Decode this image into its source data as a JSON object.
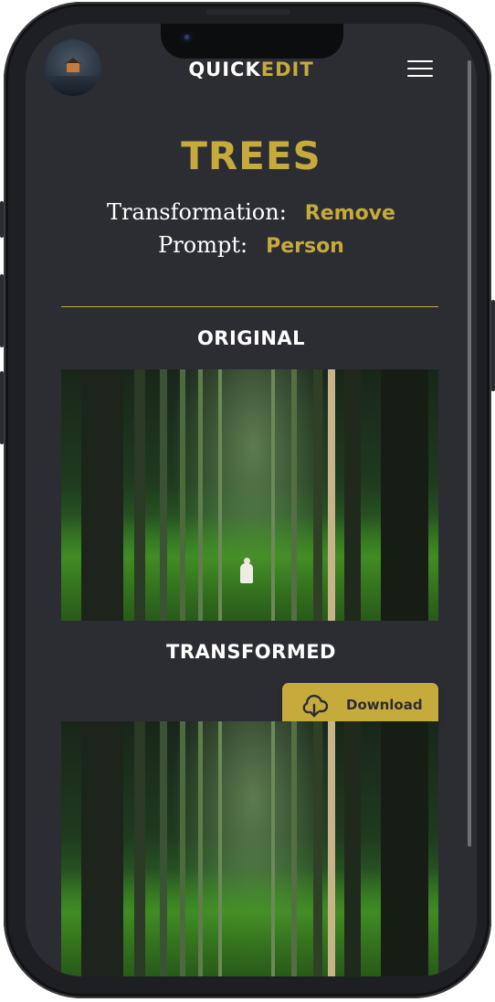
{
  "header": {
    "brand_part1": "QUICK",
    "brand_part2": "EDIT",
    "avatar_icon": "cabin-avatar",
    "menu_icon": "hamburger-menu-icon"
  },
  "page": {
    "title": "TREES",
    "transformation_label": "Transformation:",
    "transformation_value": "Remove",
    "prompt_label": "Prompt:",
    "prompt_value": "Person"
  },
  "sections": {
    "original_label": "ORIGINAL",
    "transformed_label": "TRANSFORMED"
  },
  "download": {
    "label": "Download",
    "icon": "cloud-download-icon"
  },
  "colors": {
    "background": "#2b2d33",
    "accent": "#c6aa3b",
    "text": "#ffffff"
  }
}
